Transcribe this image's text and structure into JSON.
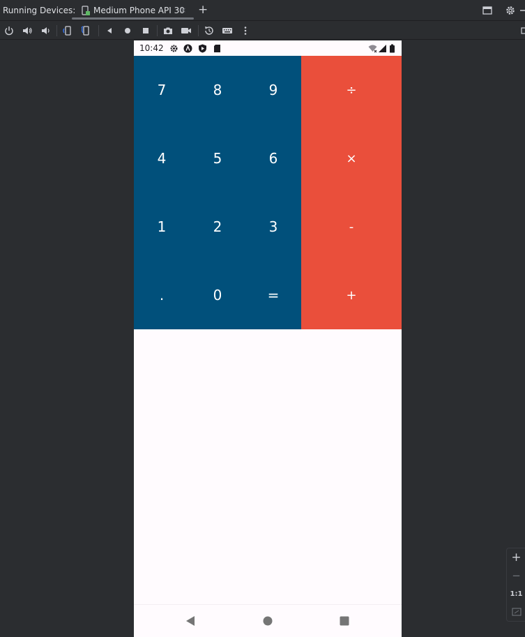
{
  "header": {
    "title": "Running Devices:",
    "tab_label": "Medium Phone API 30",
    "tab_close": "×",
    "add_tab": "+"
  },
  "toolbar": {
    "icons": [
      "power-icon",
      "volume-up-icon",
      "volume-down-icon",
      "rotate-left-icon",
      "rotate-right-icon",
      "back-icon",
      "home-icon",
      "overview-icon",
      "camera-icon",
      "screen-record-icon",
      "snapshot-icon",
      "keyboard-icon",
      "more-icon"
    ]
  },
  "device": {
    "status": {
      "time": "10:42",
      "icons": [
        "settings-icon",
        "notification-a-icon",
        "play-protect-icon",
        "sd-card-icon",
        "wifi-icon",
        "signal-icon",
        "battery-icon"
      ]
    },
    "numpad": [
      "7",
      "8",
      "9",
      "4",
      "5",
      "6",
      "1",
      "2",
      "3",
      ".",
      "0",
      "="
    ],
    "operators": [
      "÷",
      "×",
      "-",
      "+"
    ],
    "colors": {
      "numpad_bg": "#01507b",
      "operators_bg": "#ea4f3b",
      "screen_bg": "#fffbfe"
    }
  },
  "zoom": {
    "zoom_in": "+",
    "zoom_out": "−",
    "actual_size": "1:1"
  }
}
